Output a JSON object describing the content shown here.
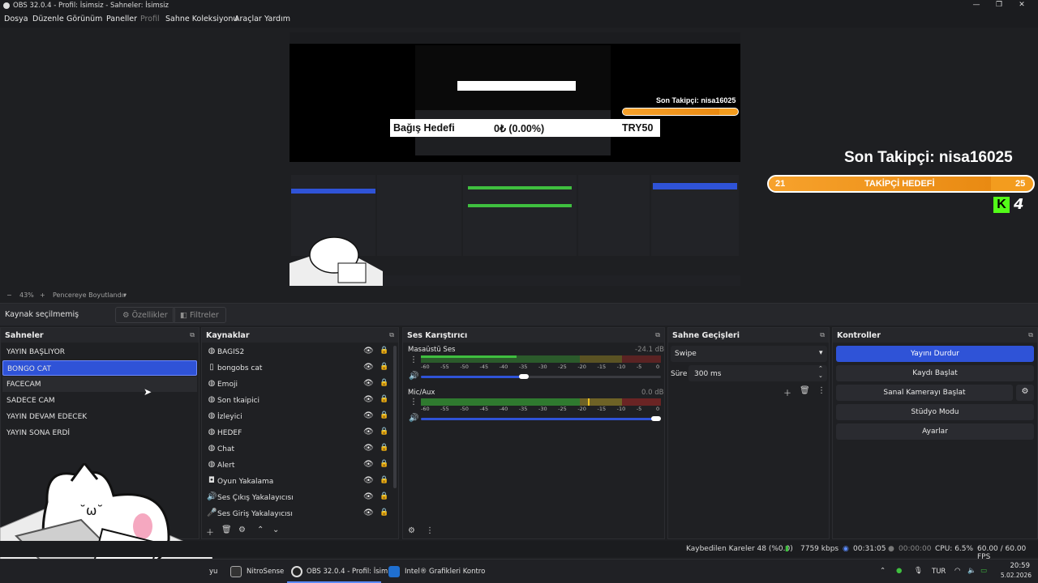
{
  "window": {
    "title": "OBS 32.0.4 - Profil: İsimsiz - Sahneler: İsimsiz",
    "minimize": "—",
    "maximize": "❐",
    "close": "✕"
  },
  "menu": [
    "Dosya",
    "Düzenle",
    "Görünüm",
    "Paneller",
    "Profil",
    "Sahne Koleksiyonu",
    "Araçlar",
    "Yardım"
  ],
  "overlay": {
    "follower_text": "Son Takipçi: nisa16025",
    "goal_label": "TAKİPÇİ HEDEFİ",
    "goal_current": "21",
    "goal_target": "25",
    "goal_fraction": 0.84,
    "kick_badge": "4",
    "donation_label": "Bağış Hedefi",
    "donation_amount": "0₺ (0.00%)",
    "donation_target": "TRY50"
  },
  "zoom": {
    "minus": "−",
    "value": "43%",
    "plus": "+",
    "mode": "Pencereye Boyutlandır"
  },
  "source_bar": {
    "status": "Kaynak seçilmemiş",
    "properties": "Özellikler",
    "filters": "Filtreler"
  },
  "scenes": {
    "title": "Sahneler",
    "items": [
      "YAYIN BAŞLIYOR",
      "BONGO CAT",
      "FACECAM",
      "SADECE CAM",
      "YAYIN DEVAM EDECEK",
      "YAYIN SONA ERDİ"
    ],
    "selected": "BONGO CAT"
  },
  "sources": {
    "title": "Kaynaklar",
    "items": [
      {
        "name": "BAGIS2",
        "icon": "globe"
      },
      {
        "name": "bongobs cat",
        "icon": "page"
      },
      {
        "name": "Emoji",
        "icon": "globe"
      },
      {
        "name": "Son tkaipici",
        "icon": "globe"
      },
      {
        "name": "İzleyici",
        "icon": "globe"
      },
      {
        "name": "HEDEF",
        "icon": "globe"
      },
      {
        "name": "Chat",
        "icon": "globe"
      },
      {
        "name": "Alert",
        "icon": "globe"
      },
      {
        "name": "Oyun Yakalama",
        "icon": "gamepad"
      },
      {
        "name": "Ses Çıkış Yakalayıcısı",
        "icon": "speaker"
      },
      {
        "name": "Ses Giriş Yakalayıcısı",
        "icon": "mic"
      }
    ]
  },
  "mixer": {
    "title": "Ses Karıştırıcı",
    "channels": [
      {
        "name": "Masaüstü Ses",
        "db": "-24.1 dB",
        "level": 0.4,
        "volume": 0.83
      },
      {
        "name": "Mic/Aux",
        "db": "0.0 dB",
        "level": 0.67,
        "volume": 1.0
      }
    ],
    "scale": [
      "-60",
      "-55",
      "-50",
      "-45",
      "-40",
      "-35",
      "-30",
      "-25",
      "-20",
      "-15",
      "-10",
      "-5",
      "0"
    ]
  },
  "transitions": {
    "title": "Sahne Geçişleri",
    "selected": "Swipe",
    "duration_label": "Süre",
    "duration_value": "300 ms"
  },
  "controls": {
    "title": "Kontroller",
    "buttons": [
      "Yayını Durdur",
      "Kaydı Başlat",
      "Sanal Kamerayı Başlat",
      "Stüdyo Modu",
      "Ayarlar"
    ]
  },
  "status": {
    "dropped": "Kaybedilen Kareler 48 (%0.0)",
    "bitrate": "7759 kbps",
    "stream_time": "00:31:05",
    "rec_time": "00:00:00",
    "cpu": "CPU: 6.5%",
    "fps": "60.00 / 60.00 FPS"
  },
  "taskbar": {
    "partial": "yu",
    "apps": [
      "NitroSense",
      "OBS 32.0.4 - Profil: İsim",
      "Intel® Grafikleri Kontro"
    ],
    "lang": "TUR",
    "time": "20:59",
    "date": "5.02.2026"
  },
  "colors": {
    "accent": "#2f53d7",
    "goal_orange": "#f39c1e",
    "kick_green": "#53fc18",
    "meter_green": "#3fbf3f",
    "meter_yellow": "#c8b43a",
    "meter_red": "#c43a3a"
  }
}
